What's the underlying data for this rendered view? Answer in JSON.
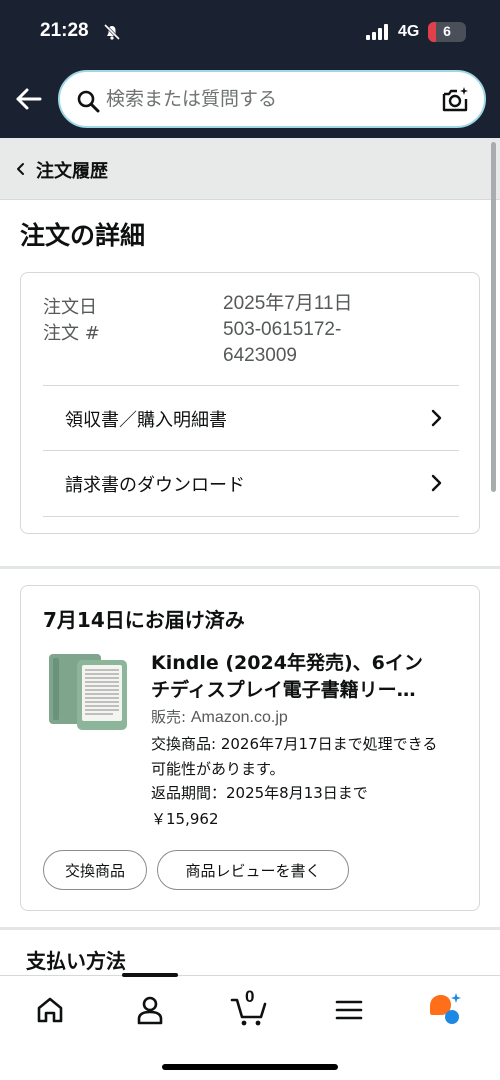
{
  "status_bar": {
    "time": "21:28",
    "network": "4G",
    "battery": "6",
    "battery_level": 0.06
  },
  "search": {
    "placeholder": "検索または質問する"
  },
  "breadcrumb": {
    "label": "注文履歴"
  },
  "page_title": "注文の詳細",
  "order": {
    "date_label": "注文日",
    "date_value": "2025年7月11日",
    "number_label": "注文 #",
    "number_value_line1": "503-0615172-",
    "number_value_line2": "6423009",
    "links": [
      {
        "label": "領収書／購入明細書"
      },
      {
        "label": "請求書のダウンロード"
      }
    ]
  },
  "delivery": {
    "status": "7月14日にお届け済み",
    "product_title_line1": "Kindle (2024年発売)、6イン",
    "product_title_line2": "チディスプレイ電子書籍リー…",
    "sold_by_label": "販売: ",
    "seller": "Amazon.co.jp",
    "exchange_info": "交換商品: 2026年7月17日まで処理できる可能性があります。",
    "return_info": "返品期間：2025年8月13日まで",
    "price": "￥15,962",
    "buttons": {
      "exchange": "交換商品",
      "review": "商品レビューを書く"
    }
  },
  "payment": {
    "title": "支払い方法"
  },
  "bottom_nav": {
    "cart_count": "0",
    "items": [
      "home-icon",
      "account-icon",
      "cart-icon",
      "menu-icon",
      "rufus-ai-icon"
    ]
  },
  "colors": {
    "header_bg": "#1a2231",
    "search_border": "#9fd7e6",
    "ai_orange": "#ff6f1a",
    "ai_blue": "#1e88e5"
  }
}
